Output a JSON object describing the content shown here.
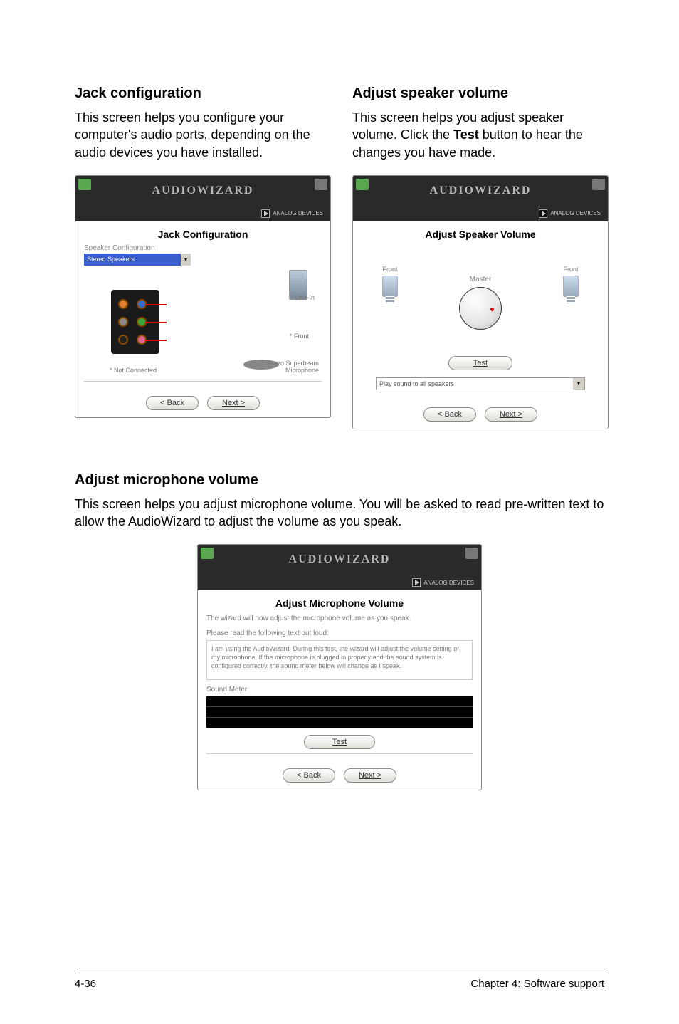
{
  "sections": {
    "jack": {
      "heading": "Jack configuration",
      "desc": "This screen helps you configure your computer's audio ports, depending on the audio devices you have installed."
    },
    "speaker": {
      "heading": "Adjust speaker volume",
      "desc_before": "This screen helps you adjust speaker volume. Click the ",
      "desc_bold": "Test",
      "desc_after": " button to hear the changes you have made."
    },
    "mic": {
      "heading": "Adjust microphone volume",
      "desc": "This screen helps you adjust microphone volume. You will be asked to read pre-written text to allow the AudioWizard to adjust the volume as you speak."
    }
  },
  "wizard": {
    "title": "AUDIOWIZARD",
    "brand": "ANALOG DEVICES",
    "jack_panel": {
      "title": "Jack Configuration",
      "dropdown_label": "Speaker Configuration",
      "dropdown_value": "Stereo Speakers",
      "labels": {
        "linein": "* Line-In",
        "front": "* Front",
        "mic": "* Stereo Superbeam Microphone",
        "not_connected": "* Not Connected"
      }
    },
    "vol_panel": {
      "title": "Adjust Speaker Volume",
      "front_l": "Front",
      "front_r": "Front",
      "master": "Master",
      "test": "Test",
      "play_to": "Play sound to all speakers"
    },
    "mic_panel": {
      "title": "Adjust Microphone Volume",
      "intro": "The wizard will now adjust the microphone volume as you speak.",
      "read_label": "Please read the following text out loud:",
      "read_text": "I am using the AudioWizard. During this test, the wizard will adjust the volume setting of my microphone. If the microphone is plugged in properly and the sound system is configured correctly, the sound meter below will change as I speak.",
      "meter_label": "Sound Meter",
      "test": "Test"
    },
    "buttons": {
      "back": "< Back",
      "next": "Next >"
    }
  },
  "footer": {
    "left": "4-36",
    "right": "Chapter 4: Software support"
  }
}
